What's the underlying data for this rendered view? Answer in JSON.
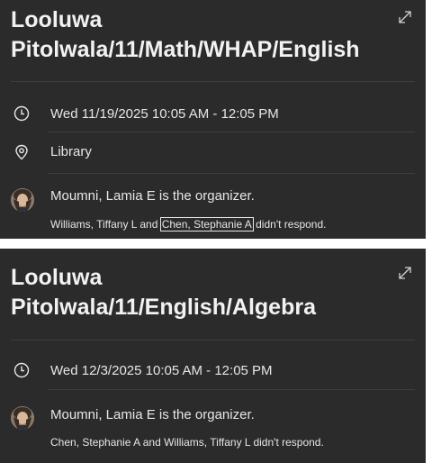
{
  "cards": [
    {
      "title_line1": "Looluwa",
      "title_line2": "Pitolwala/11/Math/WHAP/English",
      "time": "Wed 11/19/2025 10:05 AM - 12:05 PM",
      "location": "Library",
      "organizer": "Moumni, Lamia E is the organizer.",
      "resp_part1": "Williams, Tiffany L and ",
      "resp_name_boxed": "Chen, Stephanie A",
      "resp_part2": " didn't respond."
    },
    {
      "title_line1": "Looluwa",
      "title_line2": "Pitolwala/11/English/Algebra",
      "time": "Wed 12/3/2025 10:05 AM - 12:05 PM",
      "organizer": "Moumni, Lamia E is the organizer.",
      "responses": "Chen, Stephanie A and Williams, Tiffany L didn't respond."
    }
  ],
  "icons": {
    "expand": "expand-icon",
    "clock": "clock-icon",
    "location": "location-pin-icon",
    "avatar": "organizer-avatar"
  },
  "colors": {
    "card_bg": "#2b2b2b",
    "text": "#e6e6e6",
    "divider": "#3d3d3d"
  }
}
